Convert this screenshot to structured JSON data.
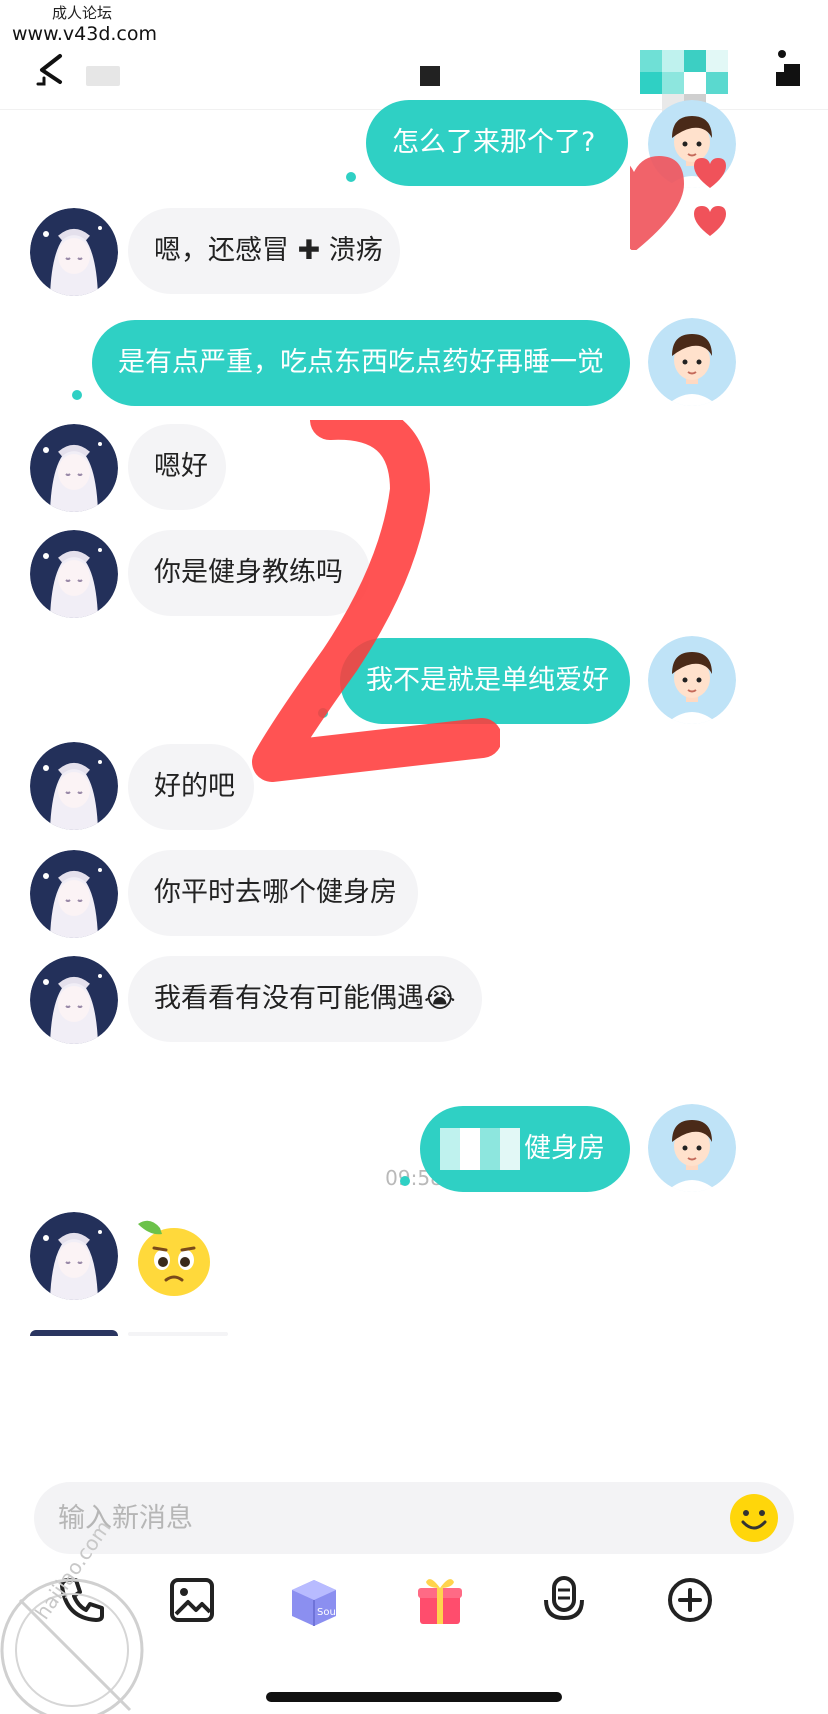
{
  "watermark": {
    "line1": "成人论坛",
    "line2": "www.v43d.com",
    "stamp_text": "haijiao.com"
  },
  "header": {
    "back_icon": "back-arrow-icon",
    "more_icon": "more-icon"
  },
  "colors": {
    "outgoing_bubble": "#2fd0c4",
    "incoming_bubble": "#f4f4f6",
    "timestamp": "#b9b9b9"
  },
  "messages": [
    {
      "side": "out",
      "text": "怎么了来那个了?"
    },
    {
      "side": "in",
      "text": "嗯，还感冒 ✚ 溃疡"
    },
    {
      "side": "out",
      "text": "是有点严重，吃点东西吃点药好再睡一觉"
    },
    {
      "side": "in",
      "text": "嗯好"
    },
    {
      "side": "in",
      "text": "你是健身教练吗"
    },
    {
      "side": "out",
      "text": "我不是就是单纯爱好"
    },
    {
      "side": "in",
      "text": "好的吧"
    },
    {
      "side": "in",
      "text": "你平时去哪个健身房"
    },
    {
      "side": "in",
      "text": "我看看有没有可能偶遇😭"
    },
    {
      "side": "out",
      "text": "健身房"
    },
    {
      "side": "in",
      "text": "🍋 emoji sticker"
    }
  ],
  "timestamp": "09:58",
  "composer": {
    "placeholder": "输入新消息",
    "emoji_icon": "smiley-icon"
  },
  "toolbar": {
    "items": [
      {
        "icon": "phone-icon"
      },
      {
        "icon": "image-icon"
      },
      {
        "icon": "soul-box-icon",
        "label": "Soul"
      },
      {
        "icon": "gift-icon"
      },
      {
        "icon": "voice-icon"
      },
      {
        "icon": "add-icon"
      }
    ]
  }
}
